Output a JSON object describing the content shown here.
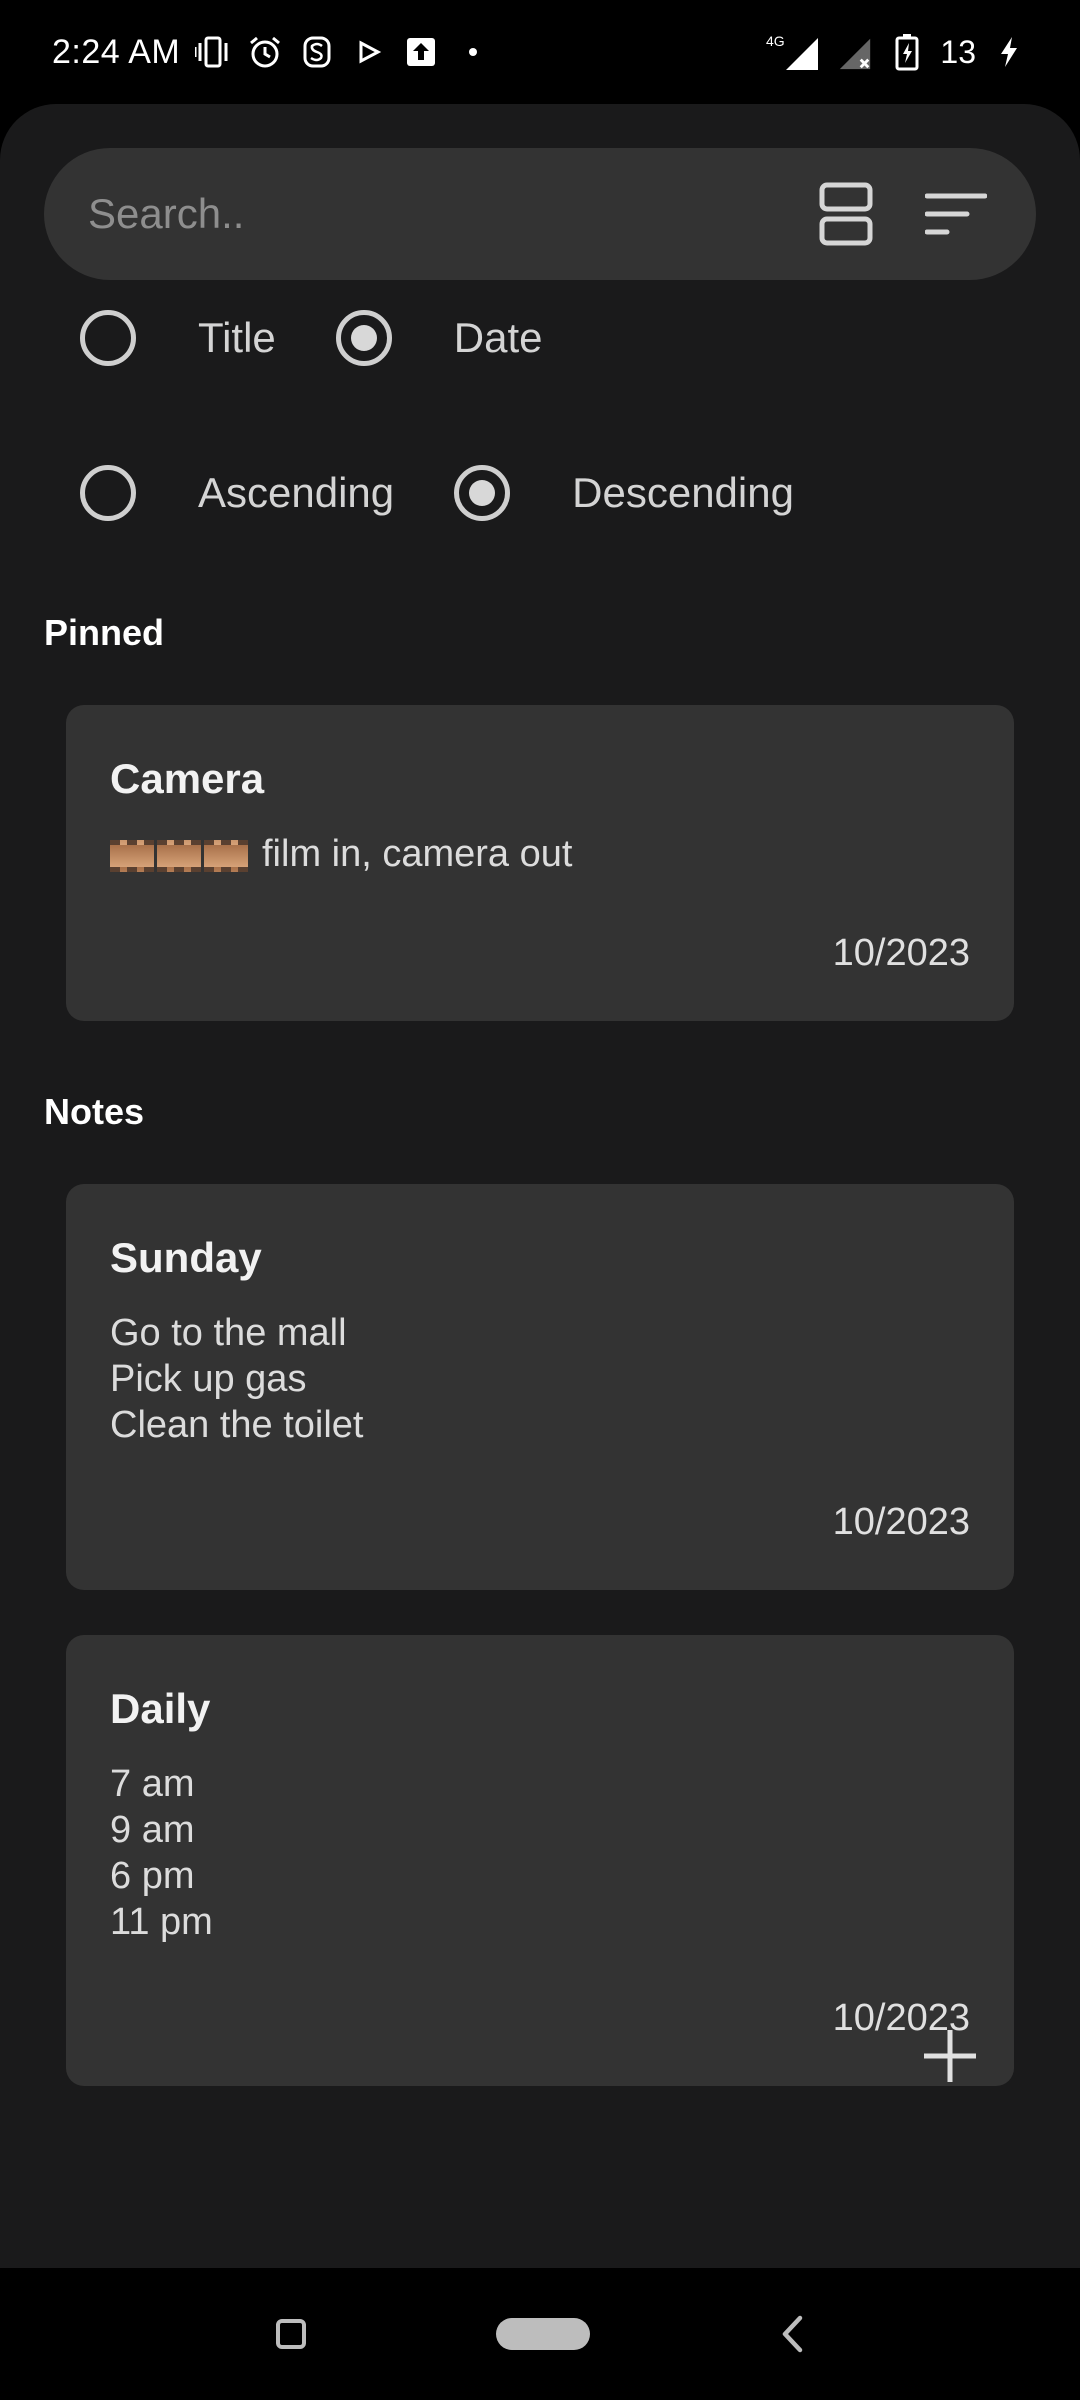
{
  "status_bar": {
    "time": "2:24 AM",
    "network": "4G",
    "battery": "13",
    "icons": [
      "vibrate-icon",
      "alarm-icon",
      "s-icon",
      "play-icon",
      "upload-icon",
      "dot-icon",
      "signal-icon",
      "no-signal-icon",
      "battery-charging-icon",
      "bolt-icon"
    ]
  },
  "search": {
    "placeholder": "Search.."
  },
  "sort": {
    "by": [
      {
        "label": "Title",
        "checked": false
      },
      {
        "label": "Date",
        "checked": true
      }
    ],
    "order": [
      {
        "label": "Ascending",
        "checked": false
      },
      {
        "label": "Descending",
        "checked": true
      }
    ]
  },
  "pinned": {
    "title": "Pinned",
    "notes": [
      {
        "title": "Camera",
        "body": [
          "film in, camera out"
        ],
        "date": "10/2023",
        "emoji": "film-frames-icon"
      }
    ]
  },
  "notes": {
    "title": "Notes",
    "items": [
      {
        "title": "Sunday",
        "body": [
          "Go to the mall",
          "Pick up gas",
          "Clean the toilet"
        ],
        "date": "10/2023"
      },
      {
        "title": "Daily",
        "body": [
          "7 am",
          "9 am",
          "6 pm",
          "11 pm"
        ],
        "date": "10/2023"
      }
    ]
  },
  "colors": {
    "background": "#000000",
    "surface": "#1a1a1b",
    "card": "#333333",
    "text": "#e6e6e6"
  }
}
